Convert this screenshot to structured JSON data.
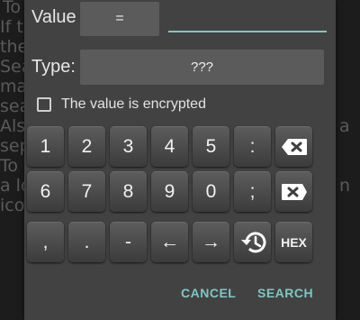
{
  "background_text": {
    "lines": [
      "To",
      "If th",
      "the",
      "Sea",
      "ma",
      "sea",
      "Als",
      "sep",
      "To",
      "a lo",
      "ico"
    ],
    "right_fragments": [
      "a",
      "n"
    ]
  },
  "dialog": {
    "value_label": "Value",
    "compare_button": "=",
    "value_input": "",
    "type_label": "Type:",
    "type_value": "???",
    "encrypted_label": "The value is encrypted",
    "encrypted_checked": false
  },
  "keypad": {
    "row1": [
      "1",
      "2",
      "3",
      "4",
      "5",
      ":"
    ],
    "row2": [
      "6",
      "7",
      "8",
      "9",
      "0",
      ";"
    ],
    "row3": [
      ",",
      ".",
      "-",
      "←",
      "→"
    ],
    "hex_label": "HEX",
    "icons": {
      "backspace_1": "backspace-icon",
      "backspace_2": "clear-icon",
      "history": "history-icon"
    }
  },
  "actions": {
    "cancel": "CANCEL",
    "search": "SEARCH"
  },
  "colors": {
    "accent": "#7fc6c4",
    "dialog_bg": "#424242"
  }
}
